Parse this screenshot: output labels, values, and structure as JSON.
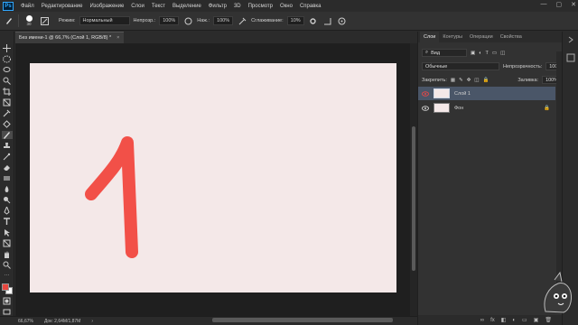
{
  "menu": {
    "logo": "Ps",
    "items": [
      "Файл",
      "Редактирование",
      "Изображение",
      "Слои",
      "Текст",
      "Выделение",
      "Фильтр",
      "3D",
      "Просмотр",
      "Окно",
      "Справка"
    ]
  },
  "options": {
    "brush_size": "30",
    "mode_label": "Режим:",
    "mode_value": "Нормальный",
    "opacity_label": "Непрозр.:",
    "opacity_value": "100%",
    "flow_label": "Наж.:",
    "flow_value": "100%",
    "smoothing_label": "Сглаживание:",
    "smoothing_value": "10%"
  },
  "document": {
    "tab_title": "Без имени-1 @ 66,7% (Слой 1, RGB/8) *",
    "close_glyph": "×",
    "canvas_color": "#f4e8e8",
    "stroke_color": "#f25048",
    "drawn_character": "1"
  },
  "status": {
    "zoom": "66,67%",
    "doc_info": "Док: 2,64M/1,87M",
    "arrow": "›"
  },
  "panels": {
    "tabs": [
      "Слои",
      "Контуры",
      "Операции",
      "Свойства"
    ],
    "filter_label": "Вид",
    "blend_mode": "Обычные",
    "opacity_label": "Непрозрачность:",
    "opacity_value": "100%",
    "lock_label": "Закрепить:",
    "fill_label": "Заливка:",
    "fill_value": "100%",
    "layers": [
      {
        "name": "Слой 1",
        "selected": true
      },
      {
        "name": "Фон",
        "selected": false
      }
    ],
    "bottom_icons": [
      "fx",
      "◧",
      "◐",
      "▭",
      "▣",
      "🗑"
    ]
  },
  "colors": {
    "foreground": "#e8473f",
    "background": "#ffffff",
    "selection": "#4a5668",
    "accent": "#31a8ff"
  }
}
